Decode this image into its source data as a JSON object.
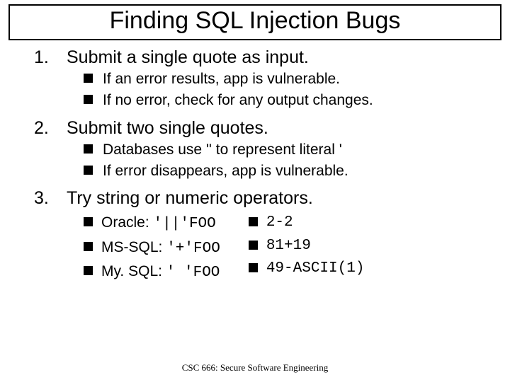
{
  "title": "Finding SQL Injection Bugs",
  "steps": [
    {
      "num": "1.",
      "text": "Submit a single quote as input.",
      "subs": [
        "If an error results, app is vulnerable.",
        "If no error, check for any output changes."
      ]
    },
    {
      "num": "2.",
      "text": "Submit two single quotes.",
      "subs": [
        "Databases use '' to represent literal '",
        "If error disappears, app is vulnerable."
      ]
    },
    {
      "num": "3.",
      "text": "Try string or numeric operators."
    }
  ],
  "ops_left": [
    {
      "label": "Oracle: ",
      "code": "'||'FOO"
    },
    {
      "label": "MS-SQL: ",
      "code": "'+'FOO"
    },
    {
      "label": "My. SQL: ",
      "code": "' 'FOO"
    }
  ],
  "ops_right": [
    {
      "code": "2-2"
    },
    {
      "code": "81+19"
    },
    {
      "code": "49-ASCII(1)"
    }
  ],
  "footer": "CSC 666: Secure Software Engineering"
}
